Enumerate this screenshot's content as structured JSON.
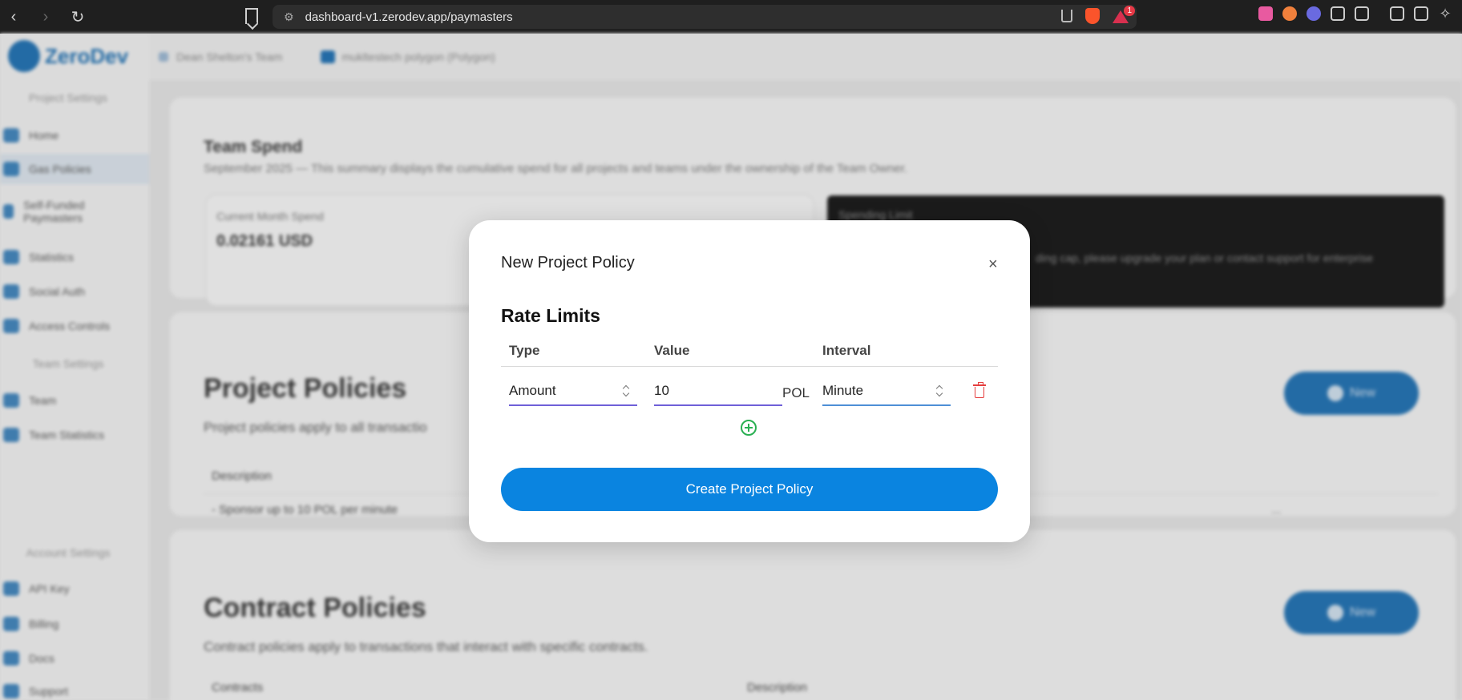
{
  "browser": {
    "url": "dashboard-v1.zerodev.app/paymasters",
    "notification_count": "1"
  },
  "app": {
    "logo_text": "ZeroDev",
    "breadcrumb_team": "Dean Shelton's Team",
    "breadcrumb_project": "mukltestech polygon (Polygon)",
    "sidebar": {
      "project_settings_label": "Project Settings",
      "items": [
        "Home",
        "Gas Policies",
        "Self-Funded Paymasters",
        "Statistics",
        "Social Auth",
        "Access Controls"
      ],
      "team_settings_label": "Team Settings",
      "team_items": [
        "Team",
        "Team Statistics"
      ],
      "account_settings_label": "Account Settings",
      "account_items": [
        "API Key",
        "Billing",
        "Docs",
        "Support"
      ]
    },
    "team_spend": {
      "title": "Team Spend",
      "subtitle": "September 2025 — This summary displays the cumulative spend for all projects and teams under the ownership of the Team Owner.",
      "current_month_label": "Current Month Spend",
      "current_month_value": "0.02161 USD",
      "notice_label": "Spending Limit",
      "notice_text": "ding cap, please upgrade your plan or contact support for enterprise"
    },
    "project_policies": {
      "title": "Project Policies",
      "subtitle": "Project policies apply to all transactio",
      "description_header": "Description",
      "row_text": "- Sponsor up to 10 POL per minute",
      "row_action": "...",
      "new_label": "New"
    },
    "contract_policies": {
      "title": "Contract Policies",
      "subtitle": "Contract policies apply to transactions that interact with specific contracts.",
      "contracts_header": "Contracts",
      "description_header": "Description",
      "new_label": "New"
    }
  },
  "modal": {
    "title": "New Project Policy",
    "close_label": "×",
    "section_title": "Rate Limits",
    "columns": {
      "type": "Type",
      "value": "Value",
      "interval": "Interval"
    },
    "row": {
      "type": "Amount",
      "value": "10",
      "unit": "POL",
      "interval": "Minute"
    },
    "submit_label": "Create Project Policy"
  },
  "colors": {
    "primary": "#0a84e0",
    "add_icon": "#2ab052",
    "delete_icon": "#e53e3e",
    "underline_purple": "#6f60d8"
  }
}
